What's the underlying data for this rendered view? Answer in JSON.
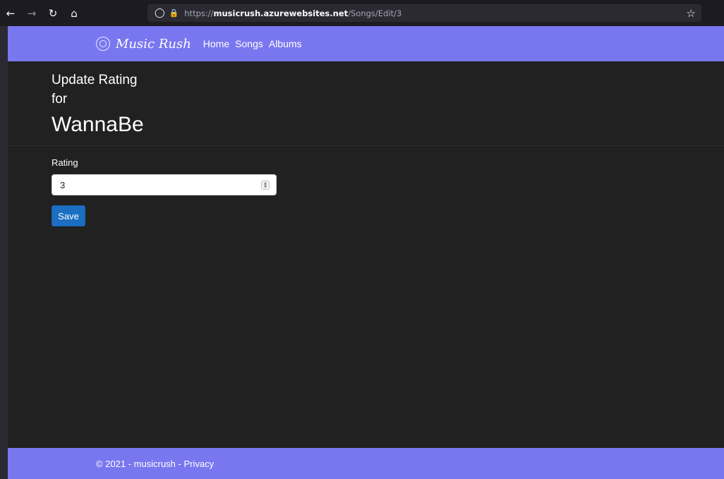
{
  "browser": {
    "back_icon": "←",
    "forward_icon": "→",
    "reload_icon": "↻",
    "home_icon": "⌂",
    "shield_icon": "◯",
    "lock_icon": "🔒",
    "url_scheme": "https://",
    "url_host": "musicrush.azurewebsites.net",
    "url_path": "/Songs/Edit/3",
    "bookmark_icon": "☆"
  },
  "header": {
    "brand": "Music Rush",
    "nav": [
      "Home",
      "Songs",
      "Albums"
    ]
  },
  "page": {
    "heading_line1": "Update Rating",
    "heading_line2": "for",
    "song_title": "WannaBe"
  },
  "form": {
    "rating_label": "Rating",
    "rating_value": "3",
    "save_label": "Save"
  },
  "footer": {
    "copyright": "© 2021 - musicrush - ",
    "privacy_label": "Privacy"
  },
  "colors": {
    "header_bg": "#7977ef",
    "page_bg": "#212121",
    "button_bg": "#1b6ec2"
  }
}
